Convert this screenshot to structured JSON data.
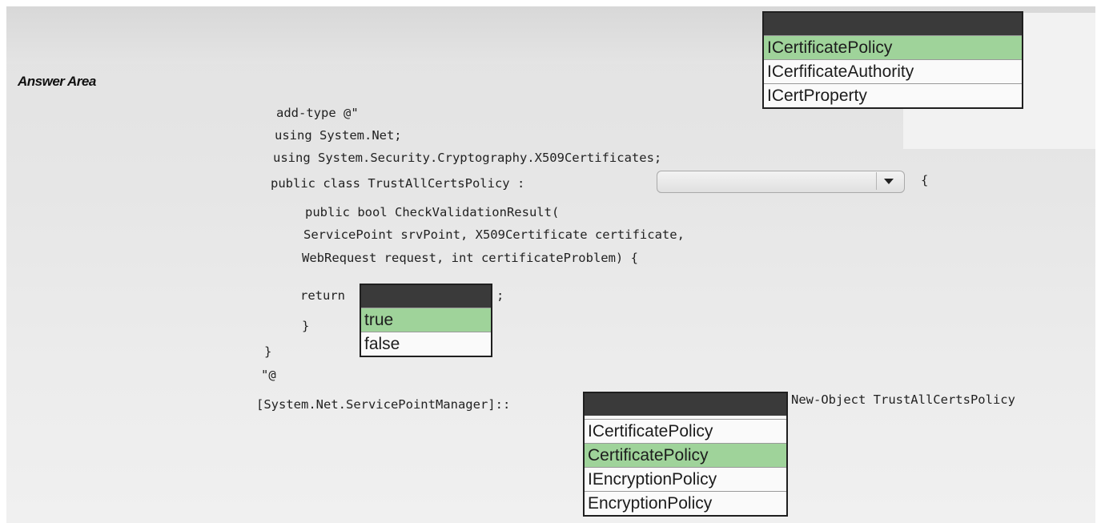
{
  "answer_area": {
    "title": "Answer Area"
  },
  "code": {
    "line1": "add-type @\"",
    "line2": "using System.Net;",
    "line3": "using System.Security.Cryptography.X509Certificates;",
    "line4": "public class TrustAllCertsPolicy :",
    "line4_brace": "{",
    "line5": "public bool CheckValidationResult(",
    "line6": "ServicePoint srvPoint, X509Certificate certificate,",
    "line7": "WebRequest request, int certificateProblem) {",
    "line8_return": "return",
    "line8_semicolon": ";",
    "line9": "}",
    "line10": "}",
    "line11": "\"@",
    "line12_prefix": "[System.Net.ServicePointManager]::",
    "line12_suffix": "New-Object TrustAllCertsPolicy"
  },
  "dropdown_base_class": {
    "options": [
      "ICertificatePolicy",
      "ICerfificateAuthority",
      "ICertProperty"
    ],
    "selected": "ICertificatePolicy"
  },
  "dropdown_return": {
    "options": [
      "true",
      "false"
    ],
    "selected": "true"
  },
  "dropdown_property": {
    "options": [
      "ICertificatePolicy",
      "CertificatePolicy",
      "IEncryptionPolicy",
      "EncryptionPolicy"
    ],
    "selected": "CertificatePolicy"
  },
  "colors": {
    "selected_option": "#9fd39a",
    "dropdown_header": "#3a3a3a",
    "background": "#e6e6e6"
  }
}
